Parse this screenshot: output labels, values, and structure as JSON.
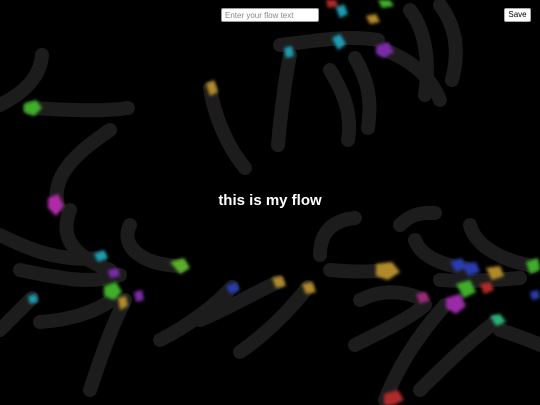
{
  "controls": {
    "input_placeholder": "Enter your flow text",
    "input_value": "",
    "save_label": "Save"
  },
  "display": {
    "flow_text": "this is my flow"
  },
  "colors": {
    "background": "#000000",
    "trail": "#1c1c1c",
    "text": "#ffffff",
    "particle_palette": [
      "#3fae2a",
      "#7a2aa8",
      "#1f9cb0",
      "#b08a2a",
      "#9a2a7a",
      "#2a3ab0",
      "#2ab07a",
      "#b02a2a"
    ]
  }
}
